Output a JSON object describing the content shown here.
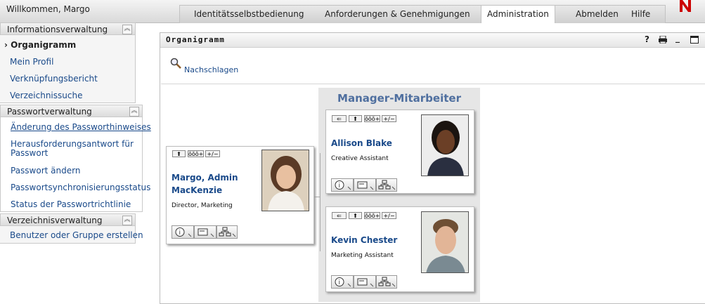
{
  "header": {
    "welcome": "Willkommen, Margo",
    "tabs": [
      {
        "label": "Identitätsselbstbedienung"
      },
      {
        "label": "Anforderungen & Genehmigungen"
      },
      {
        "label": "Administration"
      },
      {
        "label": "Abmelden"
      },
      {
        "label": "Hilfe"
      }
    ],
    "active_tab": "Administration",
    "brand_color": "#cc0000"
  },
  "sidebar": {
    "sections": [
      {
        "title": "Informationsverwaltung",
        "items": [
          {
            "label": "Organigramm"
          },
          {
            "label": "Mein Profil"
          },
          {
            "label": "Verknüpfungsbericht"
          },
          {
            "label": "Verzeichnissuche"
          }
        ]
      },
      {
        "title": "Passwortverwaltung",
        "items": [
          {
            "label": "Änderung des Passworthinweises"
          },
          {
            "label": "Herausforderungsantwort für"
          },
          {
            "label": "Passwort"
          },
          {
            "label": "Passwort ändern"
          },
          {
            "label": "Passwortsynchronisierungsstatus"
          },
          {
            "label": "Status der Passwortrichtlinie"
          }
        ]
      },
      {
        "title": "Verzeichnisverwaltung",
        "items": [
          {
            "label": "Benutzer oder Gruppe erstellen"
          }
        ]
      }
    ]
  },
  "portlet": {
    "title": "Organigramm",
    "controls": {
      "help": "?",
      "minimize": "_"
    },
    "lookup_label": "Nachschlagen"
  },
  "orgchart": {
    "manager_header": "Manager-Mitarbeiter",
    "toolbar": {
      "up": "⬆",
      "group": "ŏŏŏ+",
      "toggle": "+/−"
    },
    "manager": {
      "name_line1": "Margo, Admin",
      "name_line2": "MacKenzie",
      "title": "Director, Marketing"
    },
    "employees": [
      {
        "name": "Allison Blake",
        "title": "Creative Assistant"
      },
      {
        "name": "Kevin Chester",
        "title": "Marketing Assistant"
      }
    ]
  },
  "colors": {
    "link": "#1a4a8a",
    "manager_header": "#4f6f9f",
    "panel_bg": "#e6e6e6"
  }
}
